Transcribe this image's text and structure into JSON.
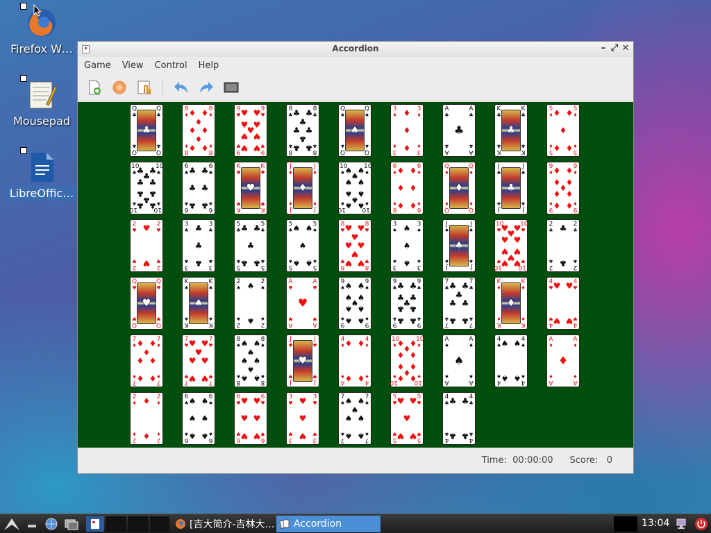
{
  "desktop": {
    "icons": [
      {
        "label": "Firefox W…",
        "icon": "firefox-icon"
      },
      {
        "label": "Mousepad",
        "icon": "notepad-icon"
      },
      {
        "label": "LibreOffic…",
        "icon": "writer-document-icon"
      }
    ]
  },
  "window": {
    "title": "Accordion",
    "menu": [
      "Game",
      "View",
      "Control",
      "Help"
    ],
    "toolbar": [
      "new-game-icon",
      "restart-icon",
      "hint-icon",
      "undo-icon",
      "redo-icon",
      "fullscreen-icon"
    ],
    "status": {
      "time_label": "Time:",
      "time_value": "00:00:00",
      "score_label": "Score:",
      "score_value": "0"
    }
  },
  "cards": [
    [
      "Q♣",
      "8♦",
      "9♥",
      "8♣",
      "Q♠",
      "3♦",
      "A♣",
      "K♣",
      "5♦"
    ],
    [
      "10♣",
      "6♣",
      "K♥",
      "J♦",
      "10♠",
      "6♦",
      "Q♦",
      "J♣",
      "9♦"
    ],
    [
      "2♥",
      "3♣",
      "5♣",
      "5♠",
      "8♥",
      "3♠",
      "J♠",
      "10♥",
      "2♣"
    ],
    [
      "Q♥",
      "K♠",
      "2♠",
      "A♥",
      "9♠",
      "9♣",
      "7♣",
      "K♦",
      "4♥"
    ],
    [
      "7♦",
      "7♥",
      "8♠",
      "J♥",
      "4♦",
      "10♦",
      "A♠",
      "4♠",
      "A♦"
    ],
    [
      "2♦",
      "6♠",
      "6♥",
      "3♥",
      "7♠",
      "5♥",
      "4♣"
    ]
  ],
  "taskbar": {
    "tasks": [
      {
        "label": "[吉大简介-吉林大…",
        "icon": "firefox-icon",
        "active": false
      },
      {
        "label": "Accordion",
        "icon": "cards-icon",
        "active": true
      }
    ],
    "clock": "13:04"
  }
}
